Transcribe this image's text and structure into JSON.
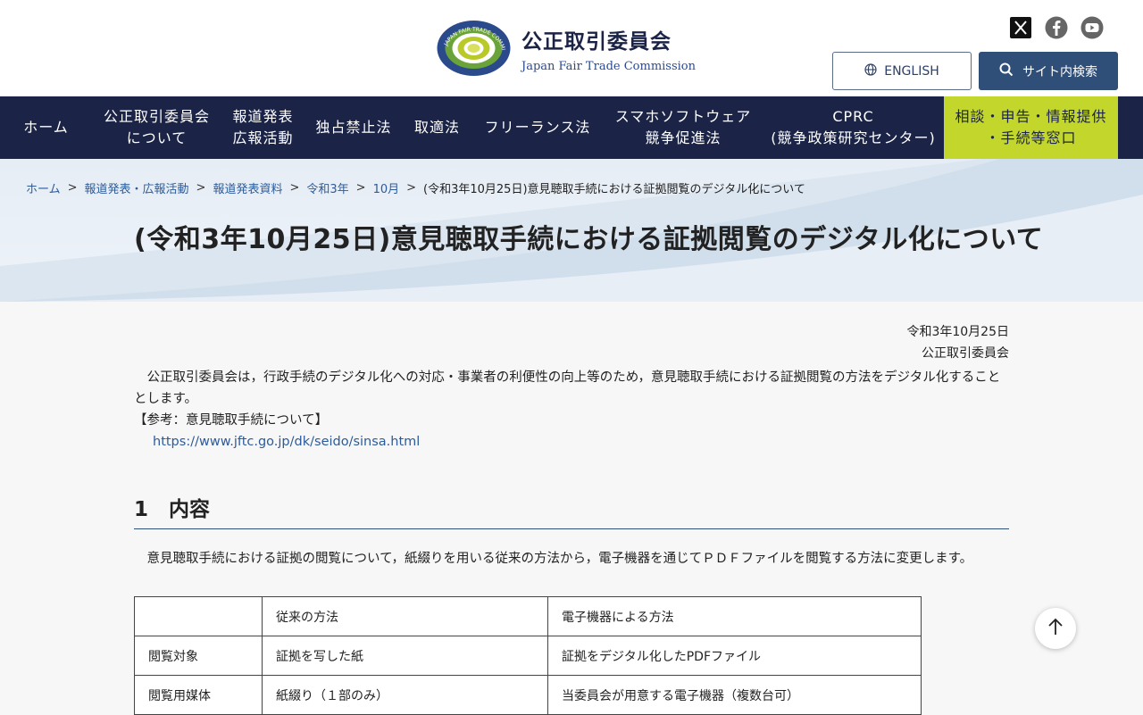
{
  "header": {
    "logo_jp": "公正取引委員会",
    "logo_en": "Japan Fair Trade Commission",
    "logo_ring_text": "JAPAN FAIR TRADE COMMISSION",
    "english_label": "ENGLISH",
    "search_label": "サイト内検索",
    "social": [
      "x-icon",
      "facebook-icon",
      "youtube-icon"
    ]
  },
  "nav": {
    "items": [
      {
        "label": "ホーム"
      },
      {
        "label": "公正取引委員会\nについて"
      },
      {
        "label": "報道発表\n広報活動"
      },
      {
        "label": "独占禁止法"
      },
      {
        "label": "取適法"
      },
      {
        "label": "フリーランス法"
      },
      {
        "label": "スマホソフトウェア\n競争促進法"
      },
      {
        "label": "CPRC\n(競争政策研究センター)"
      },
      {
        "label": "相談・申告・情報提供\n・手続等窓口"
      }
    ]
  },
  "breadcrumb": {
    "items": [
      "ホーム",
      "報道発表・広報活動",
      "報道発表資料",
      "令和3年",
      "10月"
    ],
    "current": "(令和3年10月25日)意見聴取手続における証拠閲覧のデジタル化について",
    "separator": ">"
  },
  "page": {
    "title": "(令和3年10月25日)意見聴取手続における証拠閲覧のデジタル化について",
    "date": "令和3年10月25日",
    "org": "公正取引委員会",
    "intro": "　公正取引委員会は，行政手続のデジタル化への対応・事業者の利便性の向上等のため，意見聴取手続における証拠閲覧の方法をデジタル化することとします。",
    "ref_label": "【参考：意見聴取手続について】",
    "ref_url": "https://www.jftc.go.jp/dk/seido/sinsa.html",
    "section1_title": "1　内容",
    "section1_body": "　意見聴取手続における証拠の閲覧について，紙綴りを用いる従来の方法から，電子機器を通じてＰＤＦファイルを閲覧する方法に変更します。"
  },
  "table": {
    "headers": [
      "",
      "従来の方法",
      "電子機器による方法"
    ],
    "rows": [
      [
        "閲覧対象",
        "証拠を写した紙",
        "証拠をデジタル化したPDFファイル"
      ],
      [
        "閲覧用媒体",
        "紙綴り（１部のみ）",
        "当委員会が用意する電子機器（複数台可）"
      ]
    ]
  },
  "colors": {
    "navy": "#1b2346",
    "button_blue": "#2f4e78",
    "accent_green": "#c2d62b",
    "link": "#2d5b9a"
  }
}
